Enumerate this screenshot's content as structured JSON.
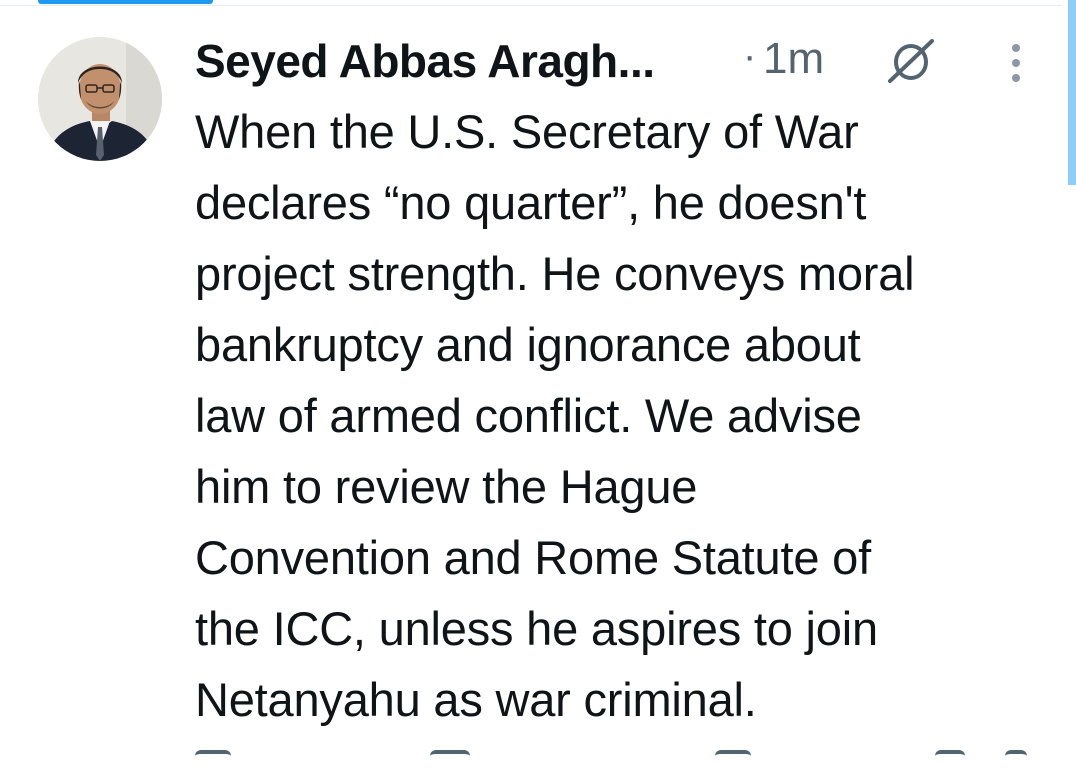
{
  "tweet": {
    "author": "Seyed Abbas Aragh...",
    "separator": "·",
    "time": "1m",
    "lines": [
      "When the U.S. Secretary of War",
      "declares “no quarter”, he doesn't",
      "project strength. He conveys moral",
      "bankruptcy and ignorance about",
      "law of armed conflict. We advise",
      "him to review the Hague",
      "Convention and Rome Statute of",
      "the ICC, unless he aspires to join",
      "Netanyahu as war criminal."
    ]
  },
  "icons": {
    "grok": "grok-icon",
    "more": "more-vertical-icon",
    "avatar": "profile-photo"
  },
  "colors": {
    "accent": "#1d9bf0",
    "text_primary": "#0f1419",
    "text_secondary": "#536471",
    "divider": "#e6ecf0"
  }
}
